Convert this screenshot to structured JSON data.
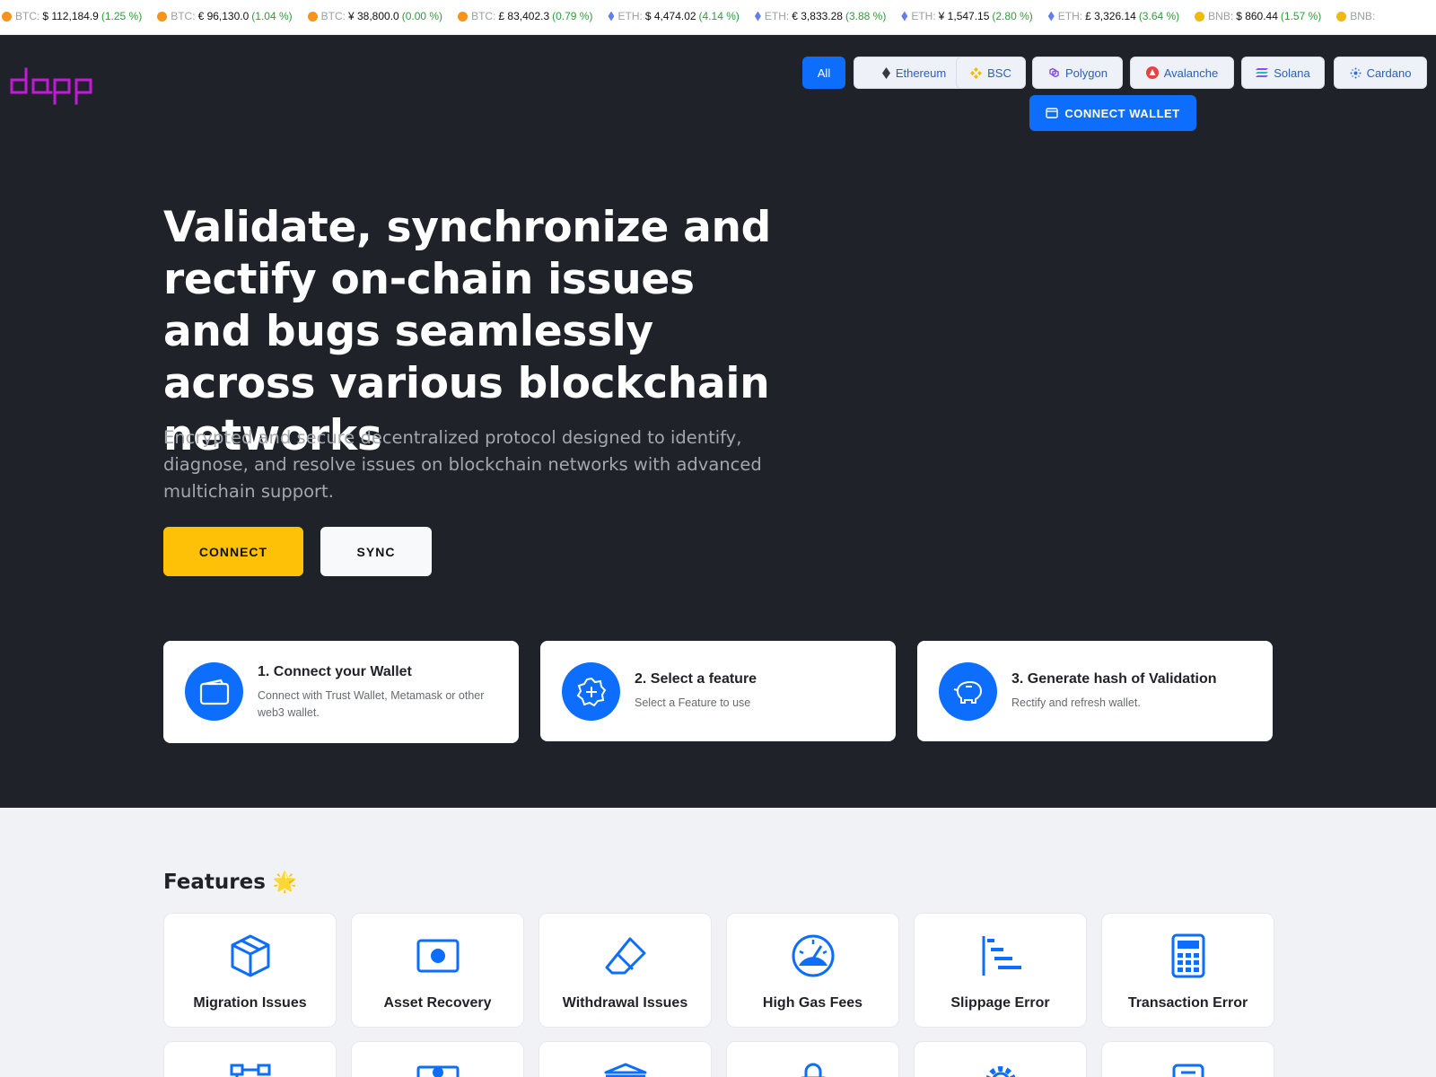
{
  "ticker": [
    {
      "coin": "btc",
      "symbol": "BTC:",
      "price": "$ 112,184.9",
      "change": "(1.25 %)"
    },
    {
      "coin": "btc",
      "symbol": "BTC:",
      "price": "€ 96,130.0",
      "change": "(1.04 %)"
    },
    {
      "coin": "btc",
      "symbol": "BTC:",
      "price": "¥ 38,800.0",
      "change": "(0.00 %)"
    },
    {
      "coin": "btc",
      "symbol": "BTC:",
      "price": "£ 83,402.3",
      "change": "(0.79 %)"
    },
    {
      "coin": "eth",
      "symbol": "ETH:",
      "price": "$ 4,474.02",
      "change": "(4.14 %)"
    },
    {
      "coin": "eth",
      "symbol": "ETH:",
      "price": "€ 3,833.28",
      "change": "(3.88 %)"
    },
    {
      "coin": "eth",
      "symbol": "ETH:",
      "price": "¥ 1,547.15",
      "change": "(2.80 %)"
    },
    {
      "coin": "eth",
      "symbol": "ETH:",
      "price": "£ 3,326.14",
      "change": "(3.64 %)"
    },
    {
      "coin": "bnb",
      "symbol": "BNB:",
      "price": "$ 860.44",
      "change": "(1.57 %)"
    },
    {
      "coin": "bnb",
      "symbol": "BNB:",
      "price": "",
      "change": ""
    }
  ],
  "header": {
    "logo_text": "dapp",
    "chains": [
      {
        "label": "All",
        "icon": "none"
      },
      {
        "label": "Ethereum",
        "icon": "ethereum-icon"
      },
      {
        "label": "BSC",
        "icon": "bsc-icon"
      },
      {
        "label": "Polygon",
        "icon": "polygon-icon"
      },
      {
        "label": "Avalanche",
        "icon": "avalanche-icon"
      },
      {
        "label": "Solana",
        "icon": "solana-icon"
      },
      {
        "label": "Cardano",
        "icon": "cardano-icon"
      }
    ],
    "connect_wallet_label": "CONNECT WALLET"
  },
  "hero": {
    "headline": "Validate, synchronize and rectify on-chain issues and bugs seamlessly across various blockchain networks",
    "subline": "Encrypted and secure decentralized protocol designed to identify, diagnose, and resolve issues on blockchain networks with advanced multichain support.",
    "connect_label": "CONNECT",
    "sync_label": "SYNC"
  },
  "steps": [
    {
      "title": "1. Connect your Wallet",
      "desc": "Connect with Trust Wallet, Metamask or other web3 wallet.",
      "icon": "wallet-icon"
    },
    {
      "title": "2. Select a feature",
      "desc": "Select a Feature to use",
      "icon": "badge-plus-icon"
    },
    {
      "title": "3. Generate hash of Validation",
      "desc": "Rectify and refresh wallet.",
      "icon": "piggy-bank-icon"
    }
  ],
  "features": {
    "title": "Features",
    "emoji": "🌟",
    "items": [
      {
        "label": "Migration Issues",
        "icon": "box-icon"
      },
      {
        "label": "Asset Recovery",
        "icon": "record-icon"
      },
      {
        "label": "Withdrawal Issues",
        "icon": "eraser-icon"
      },
      {
        "label": "High Gas Fees",
        "icon": "speedometer-icon"
      },
      {
        "label": "Slippage Error",
        "icon": "sort-bars-icon"
      },
      {
        "label": "Transaction Error",
        "icon": "calculator-icon"
      }
    ],
    "row2_icons": [
      "diagram-icon",
      "cash-icon",
      "bank-icon",
      "lock-icon",
      "gear-icon",
      "document-icon"
    ]
  },
  "colors": {
    "hero_bg": "#1f2228",
    "accent_blue": "#0d6efd",
    "connect_yellow": "#ffc107",
    "logo_magenta": "#c21bd6",
    "positive_green": "#2e9b3a"
  }
}
